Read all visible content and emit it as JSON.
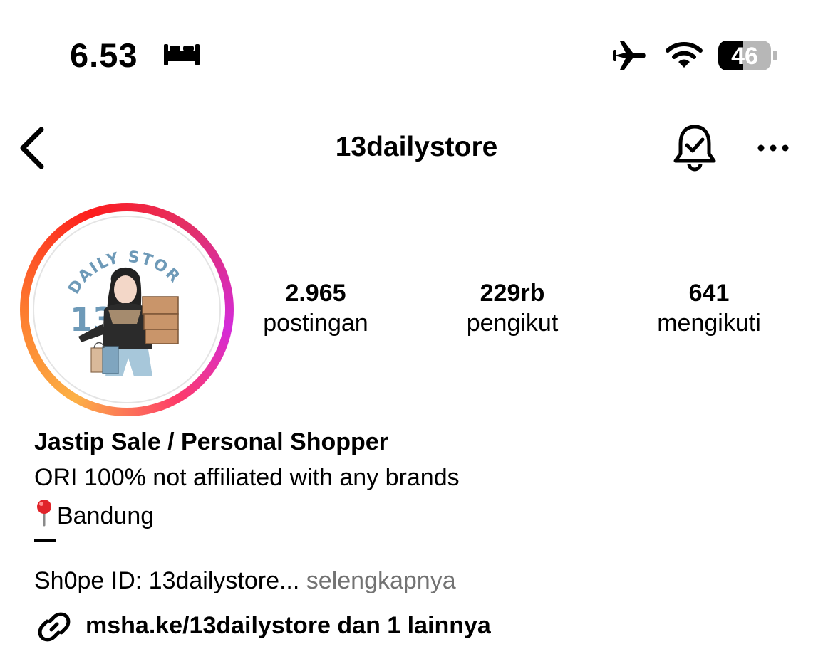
{
  "status_bar": {
    "time": "6.53",
    "battery_level": "46",
    "icons": [
      "bed-icon",
      "airplane-icon",
      "wifi-icon",
      "battery-icon"
    ]
  },
  "nav": {
    "title": "13dailystore",
    "icons": [
      "back-chevron-icon",
      "bell-check-icon",
      "more-icon"
    ]
  },
  "avatar": {
    "logo_text": "DAILY STORE",
    "logo_number": "13"
  },
  "stats": [
    {
      "value": "2.965",
      "label": "postingan"
    },
    {
      "value": "229rb",
      "label": "pengikut"
    },
    {
      "value": "641",
      "label": "mengikuti"
    }
  ],
  "bio": {
    "name": "Jastip Sale / Personal Shopper",
    "line1": "ORI 100% not affiliated with any brands",
    "line2": "Bandung",
    "line3": "Sh0pe ID: 13dailystore...",
    "more": "selengkapnya",
    "link": "msha.ke/13dailystore dan 1 lainnya"
  },
  "colors": {
    "text": "#000000",
    "muted": "#737373",
    "ring_start": "#fcb045",
    "ring_mid": "#fd1d1d",
    "ring_end": "#d42bd9",
    "logo_blue": "#6e9ab8"
  }
}
